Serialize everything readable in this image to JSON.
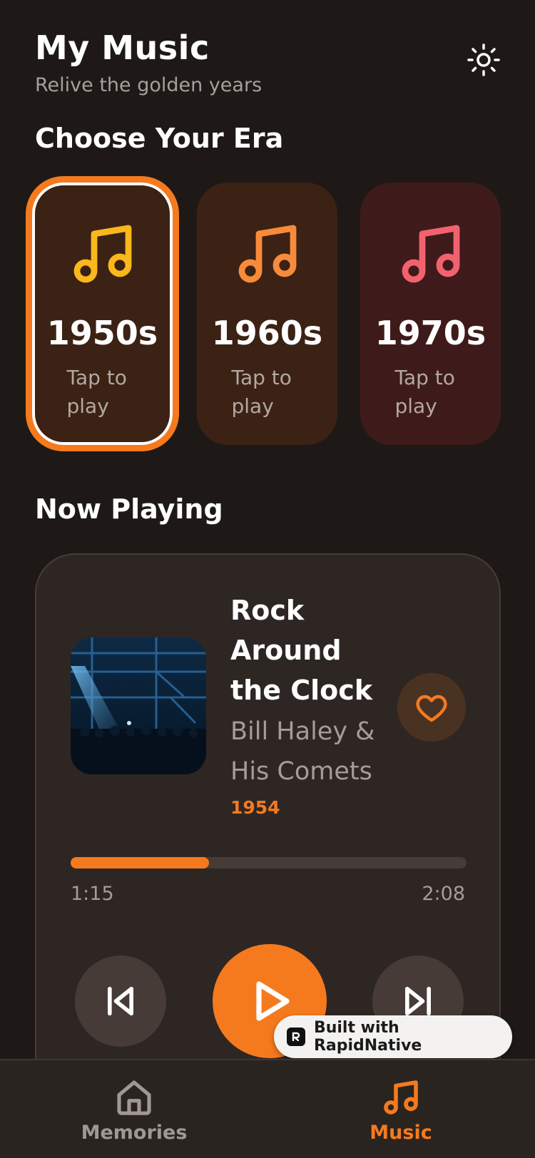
{
  "header": {
    "title": "My Music",
    "subtitle": "Relive the golden years",
    "theme_icon": "sun-icon"
  },
  "eras": {
    "section_title": "Choose Your Era",
    "items": [
      {
        "year": "1950s",
        "action": "Tap to play",
        "selected": true,
        "icon": "music-note-icon",
        "color": "#f9b81c"
      },
      {
        "year": "1960s",
        "action": "Tap to play",
        "selected": false,
        "icon": "music-note-icon",
        "color": "#f88b3a"
      },
      {
        "year": "1970s",
        "action": "Tap to play",
        "selected": false,
        "icon": "music-note-icon",
        "color": "#f2626e"
      }
    ]
  },
  "now_playing": {
    "section_title": "Now Playing",
    "track_title": "Rock Around the Clock",
    "artist": "Bill Haley & His Comets",
    "year": "1954",
    "elapsed": "1:15",
    "duration": "2:08",
    "progress": 0.35,
    "favorite_icon": "heart-icon",
    "controls": [
      "previous-icon",
      "play-icon",
      "next-icon"
    ]
  },
  "badge": {
    "label": "Built with RapidNative"
  },
  "tabs": [
    {
      "label": "Memories",
      "icon": "home-icon",
      "active": false
    },
    {
      "label": "Music",
      "icon": "music-note-icon",
      "active": true
    }
  ],
  "colors": {
    "accent": "#f57a1e",
    "background": "#1e1917",
    "card": "#2e2623"
  }
}
